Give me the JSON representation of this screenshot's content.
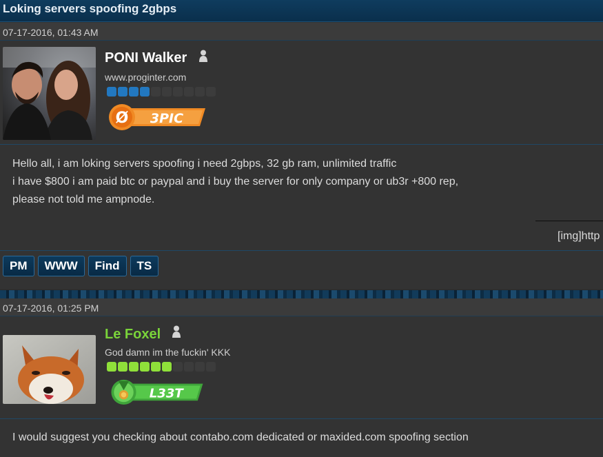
{
  "thread": {
    "title": "Loking servers spoofing 2gbps"
  },
  "posts": [
    {
      "date": "07-17-2016, 01:43 AM",
      "username": "PONI Walker",
      "username_color": "#ffffff",
      "usertitle": "www.proginter.com",
      "reputation": {
        "filled": 4,
        "total": 10,
        "color": "#2278c0"
      },
      "rank": {
        "label": "3PIC",
        "badge_text": "Ø",
        "color": "#f08a24"
      },
      "message": [
        "Hello all, i am loking servers spoofing i need 2gbps, 32 gb ram, unlimited traffic",
        "i have $800 i am paid btc or paypal and i buy the server for only company or ub3r +800 rep,",
        "please not told me ampnode."
      ],
      "signature": "[img]http",
      "buttons": [
        "PM",
        "WWW",
        "Find",
        "TS"
      ]
    },
    {
      "date": "07-17-2016, 01:25 PM",
      "username": "Le Foxel",
      "username_color": "#7ad43a",
      "usertitle": "God damn im the fuckin' KKK",
      "reputation": {
        "filled": 6,
        "total": 10,
        "color": "#8fe03a"
      },
      "rank": {
        "label": "L33T",
        "color": "#49b83a"
      },
      "message": [
        "I would suggest you checking about contabo.com dedicated or maxided.com spoofing section"
      ]
    }
  ]
}
